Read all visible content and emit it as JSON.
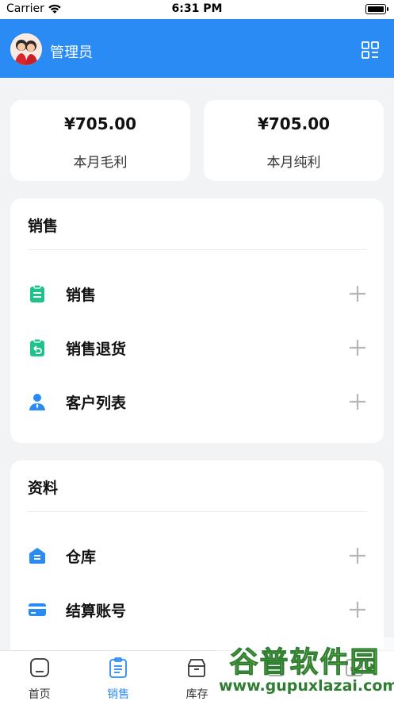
{
  "status_bar": {
    "carrier": "Carrier",
    "time": "6:31 PM"
  },
  "header": {
    "title": "管理员",
    "menu_icon": "grid-icon"
  },
  "stats": [
    {
      "value": "¥705.00",
      "label": "本月毛利"
    },
    {
      "value": "¥705.00",
      "label": "本月纯利"
    }
  ],
  "sections": [
    {
      "title": "销售",
      "items": [
        {
          "label": "销售",
          "icon": "clipboard-icon",
          "color": "#1fc28a"
        },
        {
          "label": "销售退货",
          "icon": "clipboard-return-icon",
          "color": "#1fc28a"
        },
        {
          "label": "客户列表",
          "icon": "user-icon",
          "color": "#2b8bf5"
        }
      ]
    },
    {
      "title": "资料",
      "items": [
        {
          "label": "仓库",
          "icon": "warehouse-icon",
          "color": "#2b8bf5"
        },
        {
          "label": "结算账号",
          "icon": "card-icon",
          "color": "#2b8bf5"
        }
      ]
    }
  ],
  "tabs": [
    {
      "label": "首页",
      "icon": "home-icon",
      "active": false
    },
    {
      "label": "销售",
      "icon": "clipboard-icon",
      "active": true
    },
    {
      "label": "库存",
      "icon": "box-icon",
      "active": false
    },
    {
      "label": "",
      "icon": "report-icon",
      "active": false
    },
    {
      "label": "",
      "icon": "chart-icon",
      "active": false
    }
  ],
  "watermark": {
    "brand": "谷普软件园",
    "url": "www.gupuxlazai.com"
  },
  "colors": {
    "accent": "#2b8bf5",
    "green": "#1fc28a",
    "background": "#f2f3f5"
  }
}
